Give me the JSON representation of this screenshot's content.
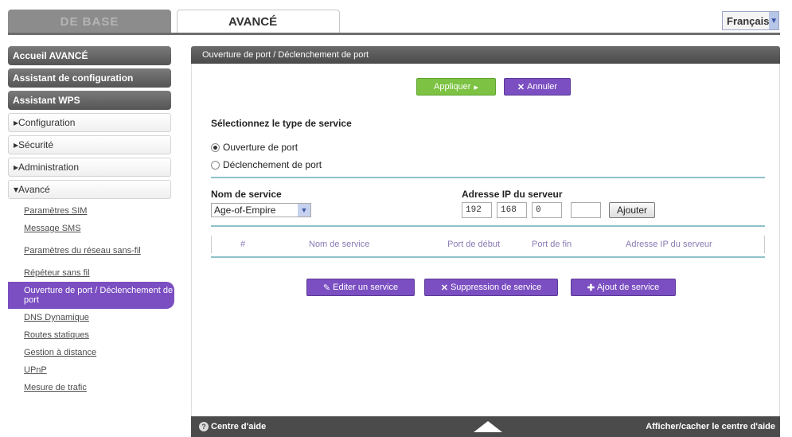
{
  "tabs": {
    "basic": "DE BASE",
    "advanced": "AVANCÉ"
  },
  "language": {
    "selected": "Français"
  },
  "sidebar": {
    "top_items": [
      "Accueil AVANCÉ",
      "Assistant de configuration",
      "Assistant WPS"
    ],
    "menu_items": [
      "Configuration",
      "Sécurité",
      "Administration",
      "Avancé"
    ],
    "sub_items": [
      "Paramètres SIM",
      "Message SMS",
      "Paramètres du réseau sans-fil",
      "Répéteur sans fil",
      "Ouverture de port / Déclenchement de port",
      "DNS Dynamique",
      "Routes statiques",
      "Gestion à distance",
      "UPnP",
      "Mesure de trafic"
    ]
  },
  "panel": {
    "title": "Ouverture de port / Déclenchement de port",
    "apply_label": "Appliquer",
    "cancel_label": "Annuler",
    "service_type_title": "Sélectionnez le type de service",
    "radio_port_forward": "Ouverture de port",
    "radio_port_trigger": "Déclenchement de port",
    "service_name_label": "Nom de service",
    "service_name_value": "Age-of-Empire",
    "server_ip_label": "Adresse IP du serveur",
    "ip": [
      "192",
      "168",
      "0",
      ""
    ],
    "add_label": "Ajouter",
    "table_headers": [
      "#",
      "Nom de service",
      "Port de début",
      "Port de fin",
      "Adresse IP du serveur"
    ],
    "edit_label": "Editer un service",
    "delete_label": "Suppression de service",
    "add_service_label": "Ajout de service"
  },
  "footer": {
    "help_label": "Centre d'aide",
    "toggle_label": "Afficher/cacher le centre d'aide"
  },
  "colors": {
    "accent_purple": "#7b4fc2",
    "apply_green": "#7dc242",
    "teal_rule": "#8fc1c8"
  }
}
